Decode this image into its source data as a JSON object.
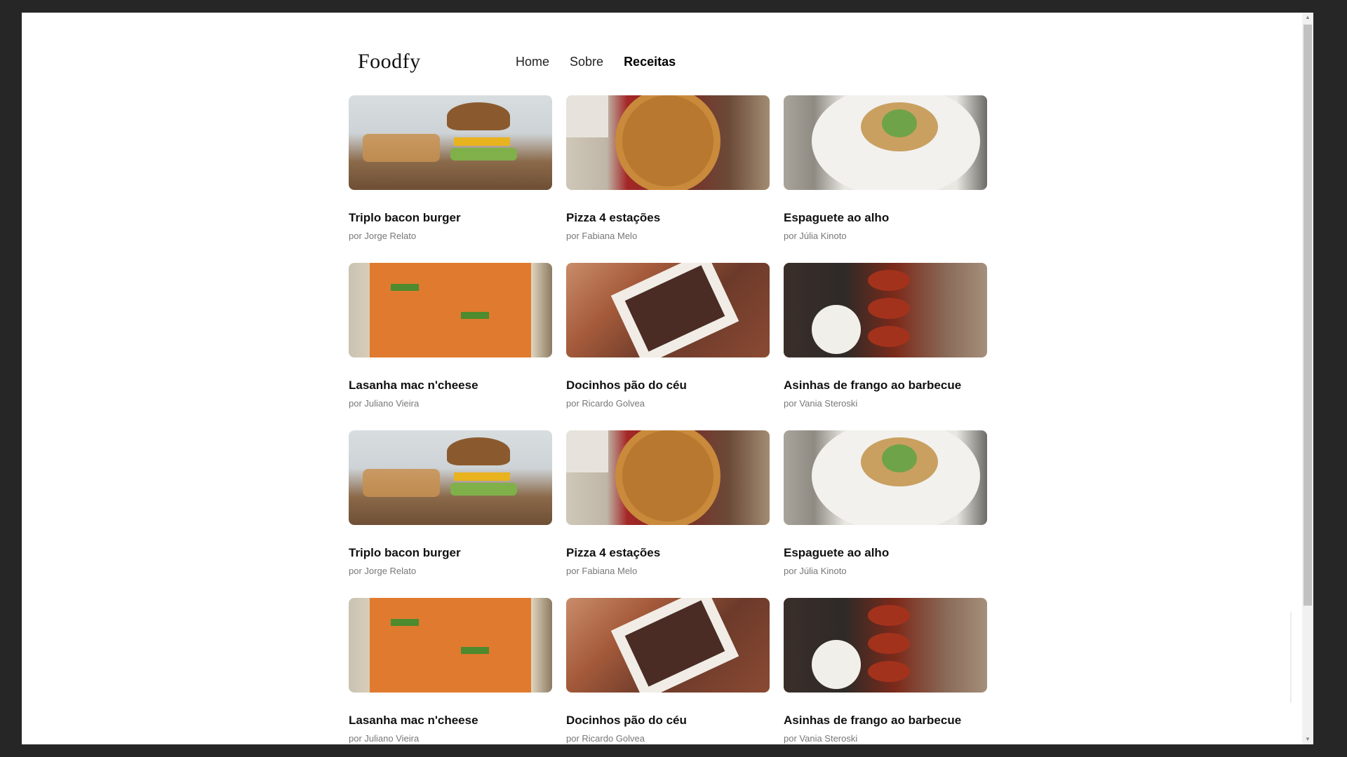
{
  "brand": {
    "logo": "Foodfy"
  },
  "nav": {
    "items": [
      "Home",
      "Sobre",
      "Receitas"
    ],
    "active": "Receitas"
  },
  "recipes": [
    {
      "title": "Triplo bacon burger",
      "author": "por Jorge Relato",
      "image": "burger"
    },
    {
      "title": "Pizza 4 estações",
      "author": "por Fabiana Melo",
      "image": "pizza"
    },
    {
      "title": "Espaguete ao alho",
      "author": "por Júlia Kinoto",
      "image": "pasta"
    },
    {
      "title": "Lasanha mac n'cheese",
      "author": "por Juliano Vieira",
      "image": "lasagna"
    },
    {
      "title": "Docinhos pão do céu",
      "author": "por Ricardo Golvea",
      "image": "candy"
    },
    {
      "title": "Asinhas de frango ao barbecue",
      "author": "por Vania Steroski",
      "image": "wings"
    },
    {
      "title": "Triplo bacon burger",
      "author": "por Jorge Relato",
      "image": "burger"
    },
    {
      "title": "Pizza 4 estações",
      "author": "por Fabiana Melo",
      "image": "pizza"
    },
    {
      "title": "Espaguete ao alho",
      "author": "por Júlia Kinoto",
      "image": "pasta"
    },
    {
      "title": "Lasanha mac n'cheese",
      "author": "por Juliano Vieira",
      "image": "lasagna"
    },
    {
      "title": "Docinhos pão do céu",
      "author": "por Ricardo Golvea",
      "image": "candy"
    },
    {
      "title": "Asinhas de frango ao barbecue",
      "author": "por Vania Steroski",
      "image": "wings"
    }
  ]
}
